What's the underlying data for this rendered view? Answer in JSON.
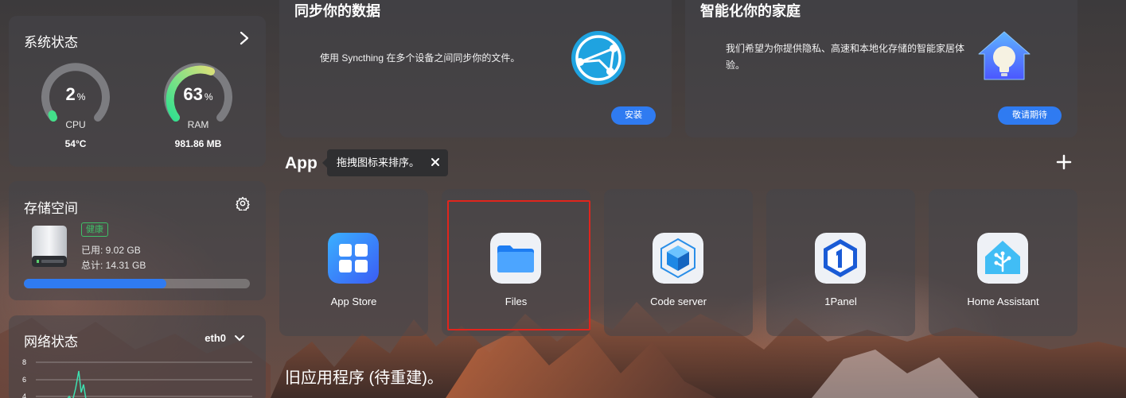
{
  "system_status": {
    "title": "系统状态",
    "cpu": {
      "value": "2",
      "unit": "%",
      "label": "CPU",
      "sub": "54°C",
      "percent": 2
    },
    "ram": {
      "value": "63",
      "unit": "%",
      "label": "RAM",
      "sub": "981.86 MB",
      "percent": 63
    }
  },
  "storage": {
    "title": "存储空间",
    "status_badge": "健康",
    "used": "已用: 9.02 GB",
    "total": "总计: 14.31 GB",
    "used_fraction": 0.63
  },
  "network": {
    "title": "网络状态",
    "interface": "eth0",
    "y_ticks": [
      "8",
      "6",
      "4"
    ]
  },
  "promos": [
    {
      "title": "同步你的数据",
      "desc": "使用 Syncthing 在多个设备之间同步你的文件。",
      "button": "安装"
    },
    {
      "title": "智能化你的家庭",
      "desc": "我们希望为你提供隐私、高速和本地化存储的智能家居体验。",
      "button": "敬请期待"
    }
  ],
  "apps_section": {
    "title": "App",
    "tooltip": "拖拽图标来排序。",
    "apps": [
      {
        "label": "App Store"
      },
      {
        "label": "Files"
      },
      {
        "label": "Code server"
      },
      {
        "label": "1Panel"
      },
      {
        "label": "Home Assistant"
      }
    ]
  },
  "legacy_title": "旧应用程序 (待重建)。",
  "colors": {
    "accent": "#2f7bf1",
    "healthy": "#3ec168",
    "focus": "#e0251d"
  }
}
